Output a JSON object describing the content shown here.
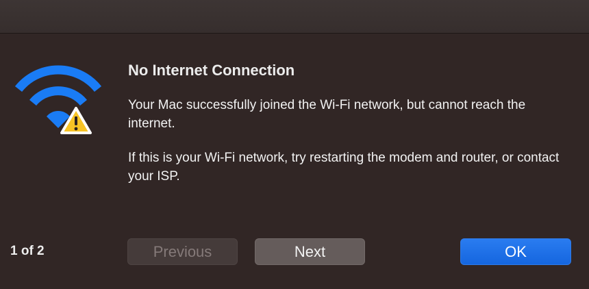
{
  "dialog": {
    "title": "No Internet Connection",
    "message_1": "Your Mac successfully joined the Wi-Fi network, but cannot reach the internet.",
    "message_2": "If this is your Wi-Fi network, try restarting the modem and router, or contact your ISP.",
    "icon": "wifi-warning-icon"
  },
  "footer": {
    "counter": "1 of 2",
    "previous_label": "Previous",
    "next_label": "Next",
    "ok_label": "OK"
  },
  "colors": {
    "wifi_blue": "#1a7cf5",
    "warning_yellow": "#f7c325",
    "ok_button_blue": "#1f6fe6",
    "background": "#312625"
  }
}
